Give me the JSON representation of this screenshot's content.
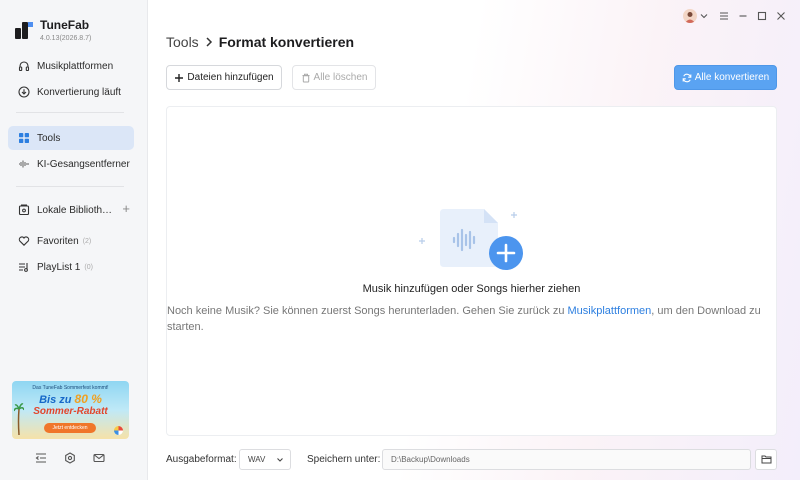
{
  "app": {
    "name": "TuneFab",
    "version": "4.0.13(2026.8.7)"
  },
  "sidebar": {
    "items": [
      {
        "label": "Musikplattformen",
        "icon": "headphones-icon"
      },
      {
        "label": "Konvertierung läuft",
        "icon": "download-circle-icon"
      },
      {
        "label": "Tools",
        "icon": "grid-icon",
        "active": true
      },
      {
        "label": "KI-Gesangsentferner",
        "icon": "waveform-icon"
      },
      {
        "label": "Lokale Biblioth…",
        "icon": "library-icon"
      },
      {
        "label": "Favoriten",
        "icon": "heart-icon",
        "count": "(2)"
      },
      {
        "label": "PlayList 1",
        "icon": "playlist-icon",
        "count": "(0)"
      }
    ],
    "add_library_label": "+",
    "promo": {
      "top": "Das TuneFab Sommerfest kommt!",
      "big_prefix": "Bis zu ",
      "big_percent": "80 %",
      "mid": "Sommer-Rabatt",
      "button": "Jetzt entdecken"
    }
  },
  "main": {
    "breadcrumb_root": "Tools",
    "breadcrumb_sep": "›",
    "breadcrumb_current": "Format konvertieren",
    "add_files_label": "Dateien hinzufügen",
    "clear_all_label": "Alle löschen",
    "convert_all_label": "Alle konvertieren",
    "dropzone": {
      "title": "Musik hinzufügen oder Songs hierher ziehen",
      "desc_before": "Noch keine Musik? Sie können zuerst Songs herunterladen. Gehen Sie zurück zu ",
      "desc_link": "Musikplattformen",
      "desc_after": ", um den Download zu starten."
    }
  },
  "footer": {
    "format_label": "Ausgabeformat:",
    "format_value": "WAV",
    "save_label": "Speichern unter:",
    "save_path": "D:\\Backup\\Downloads"
  },
  "colors": {
    "accent": "#5aa3f2",
    "link": "#2d7fe0",
    "active_nav": "#dbe6f7"
  }
}
